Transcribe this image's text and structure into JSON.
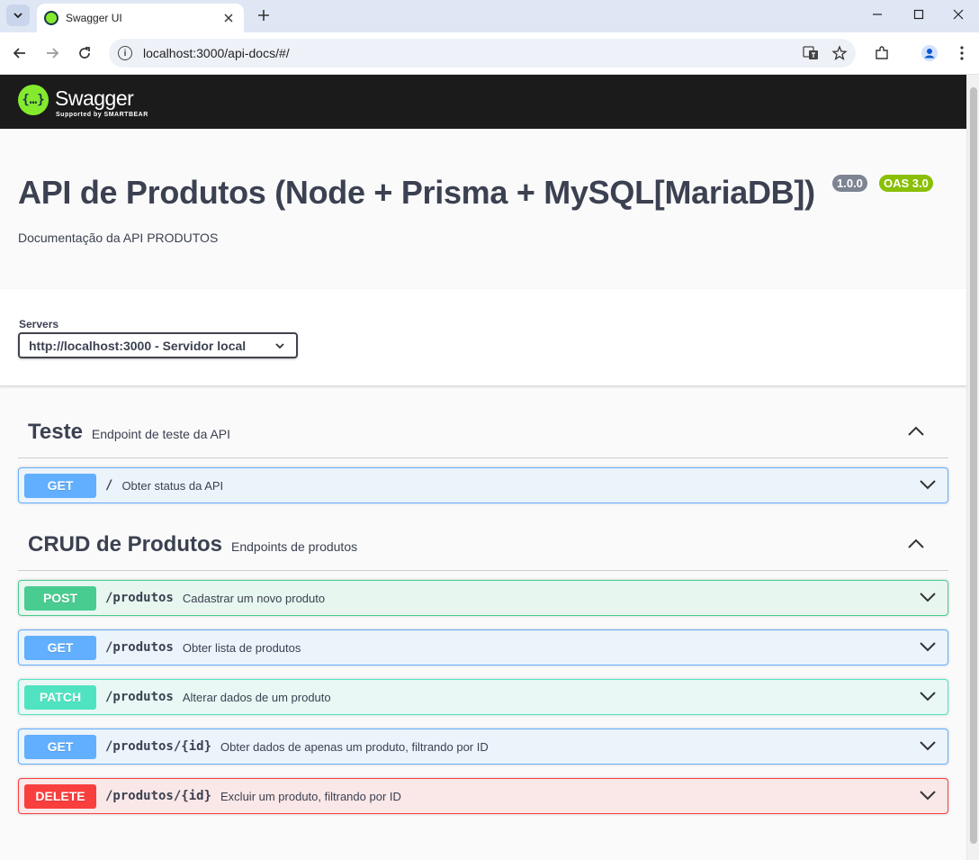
{
  "browser": {
    "tab_title": "Swagger UI",
    "url": "localhost:3000/api-docs/#/"
  },
  "swagger": {
    "logo_text": "Swagger",
    "logo_sub": "Supported by SMARTBEAR",
    "logo_symbol": "{…}"
  },
  "info": {
    "title": "API de Produtos (Node + Prisma + MySQL[MariaDB])",
    "version": "1.0.0",
    "oas": "OAS 3.0",
    "description": "Documentação da API PRODUTOS"
  },
  "servers": {
    "label": "Servers",
    "selected": "http://localhost:3000 - Servidor local"
  },
  "tags": [
    {
      "name": "Teste",
      "description": "Endpoint de teste da API",
      "operations": [
        {
          "method": "GET",
          "path": "/",
          "summary": "Obter status da API"
        }
      ]
    },
    {
      "name": "CRUD de Produtos",
      "description": "Endpoints de produtos",
      "operations": [
        {
          "method": "POST",
          "path": "/produtos",
          "summary": "Cadastrar um novo produto"
        },
        {
          "method": "GET",
          "path": "/produtos",
          "summary": "Obter lista de produtos"
        },
        {
          "method": "PATCH",
          "path": "/produtos",
          "summary": "Alterar dados de um produto"
        },
        {
          "method": "GET",
          "path": "/produtos/{id}",
          "summary": "Obter dados de apenas um produto, filtrando por ID"
        },
        {
          "method": "DELETE",
          "path": "/produtos/{id}",
          "summary": "Excluir um produto, filtrando por ID"
        }
      ]
    }
  ],
  "colors": {
    "get": "#61affe",
    "post": "#49cc90",
    "patch": "#50e3c2",
    "delete": "#f93e3e",
    "swagger_green": "#85ea2d",
    "topbar": "#1b1b1b"
  }
}
